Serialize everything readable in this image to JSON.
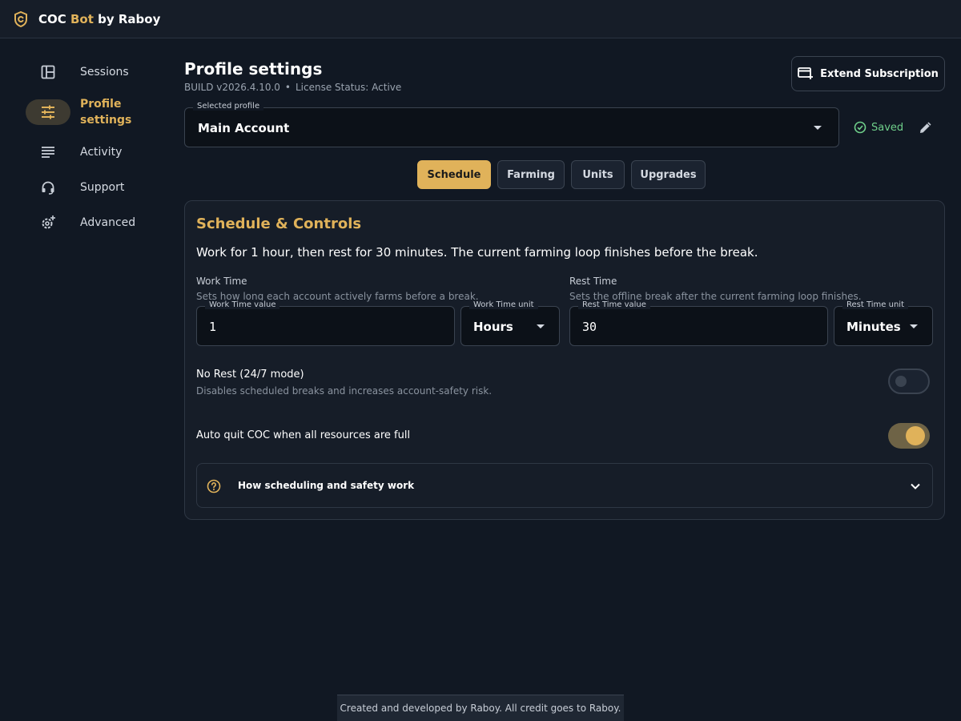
{
  "app": {
    "title_prefix": "COC ",
    "title_accent": "Bot",
    "title_suffix": " by Raboy",
    "accent_color": "#e0b25a"
  },
  "sidebar": {
    "items": [
      {
        "label": "Sessions",
        "icon": "layout-panel-icon",
        "active": false
      },
      {
        "label": "Profile settings",
        "icon": "sliders-icon",
        "active": true
      },
      {
        "label": "Activity",
        "icon": "list-lines-icon",
        "active": false
      },
      {
        "label": "Support",
        "icon": "headset-icon",
        "active": false
      },
      {
        "label": "Advanced",
        "icon": "gear-advanced-icon",
        "active": false
      }
    ]
  },
  "header": {
    "title": "Profile settings",
    "build": "BUILD v2026.4.10.0",
    "separator": "•",
    "license": "License Status: Active",
    "extend_button": "Extend Subscription"
  },
  "profile": {
    "label": "Selected profile",
    "value": "Main Account",
    "saved_text": "Saved"
  },
  "tabs": [
    {
      "label": "Schedule",
      "active": true
    },
    {
      "label": "Farming",
      "active": false
    },
    {
      "label": "Units",
      "active": false
    },
    {
      "label": "Upgrades",
      "active": false
    }
  ],
  "panel": {
    "title": "Schedule & Controls",
    "summary": "Work for 1 hour, then rest for 30 minutes. The current farming loop finishes before the break.",
    "work": {
      "title": "Work Time",
      "desc": "Sets how long each account actively farms before a break.",
      "value_label": "Work Time value",
      "value": "1",
      "unit_label": "Work Time unit",
      "unit": "Hours"
    },
    "rest": {
      "title": "Rest Time",
      "desc": "Sets the offline break after the current farming loop finishes.",
      "value_label": "Rest Time value",
      "value": "30",
      "unit_label": "Rest Time unit",
      "unit": "Minutes"
    },
    "no_rest": {
      "title": "No Rest (24/7 mode)",
      "desc": "Disables scheduled breaks and increases account-safety risk.",
      "enabled": false
    },
    "auto_quit": {
      "title": "Auto quit COC when all resources are full",
      "enabled": true
    },
    "accordion": {
      "label": "How scheduling and safety work"
    }
  },
  "footer": {
    "text": "Created and developed by Raboy. All credit goes to Raboy."
  }
}
